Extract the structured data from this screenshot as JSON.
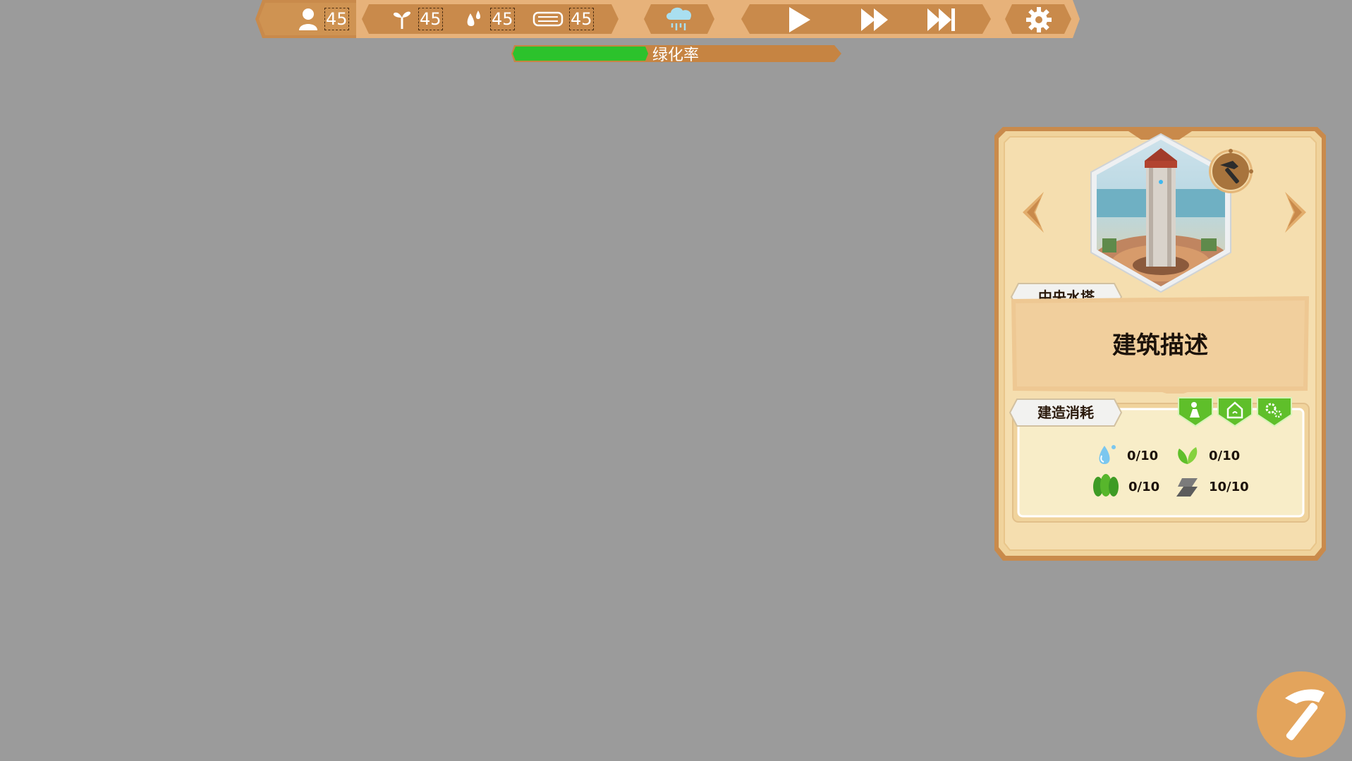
{
  "top_bar": {
    "population": {
      "icon": "person-icon",
      "value": "45"
    },
    "sprout": {
      "icon": "sprout-icon",
      "value": "45"
    },
    "water": {
      "icon": "water-drops-icon",
      "value": "45"
    },
    "material": {
      "icon": "rolled-material-icon",
      "value": "45"
    },
    "weather_icon": "rain-cloud-icon",
    "play_icon": "play-icon",
    "fast_forward_icon": "fast-forward-icon",
    "skip_icon": "skip-forward-icon",
    "settings_icon": "gear-icon"
  },
  "greening": {
    "label": "绿化率",
    "progress": 0.42,
    "fill_color": "#2cc22c"
  },
  "building_card": {
    "name": "中央水塔",
    "description": "建筑描述",
    "cost_title": "建造消耗",
    "costs": [
      {
        "icon": "water-drop-icon",
        "value": "0/10"
      },
      {
        "icon": "leaves-icon",
        "value": "0/10"
      },
      {
        "icon": "trees-icon",
        "value": "0/10"
      },
      {
        "icon": "stone-plate-icon",
        "value": "10/10"
      }
    ],
    "category_buttons": [
      "worker-icon",
      "house-icon",
      "gears-icon"
    ]
  },
  "colors": {
    "bar": "#c98a4b",
    "bar_dark": "#a86b33",
    "card_bg": "#f4dcaa",
    "card_border": "#c98a4b",
    "accent_green": "#5fbf2a"
  }
}
